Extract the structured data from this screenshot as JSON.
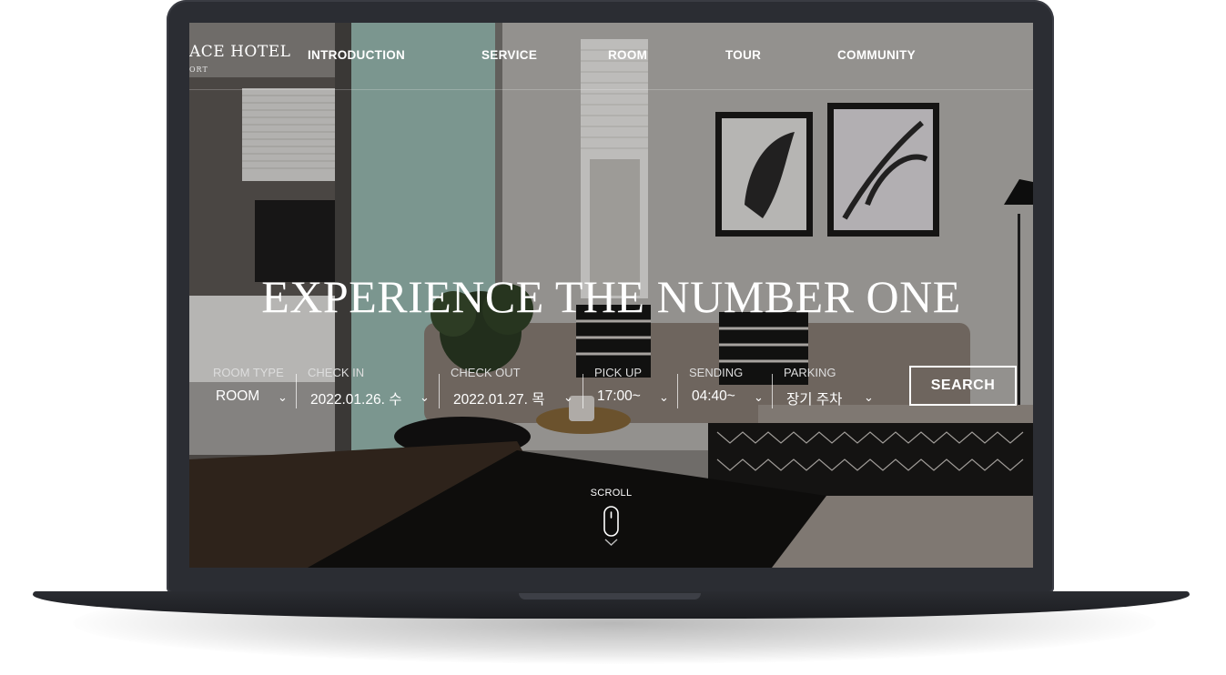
{
  "logo": {
    "name": "ACE HOTEL",
    "sub": "ORT"
  },
  "nav": {
    "items": [
      "INTRODUCTION",
      "SERVICE",
      "ROOM",
      "TOUR",
      "COMMUNITY"
    ]
  },
  "hero": {
    "title": "EXPERIENCE THE NUMBER ONE"
  },
  "booking": {
    "fields": [
      {
        "label": "ROOM TYPE",
        "value": "ROOM"
      },
      {
        "label": "CHECK IN",
        "value": "2022.01.26. 수"
      },
      {
        "label": "CHECK OUT",
        "value": "2022.01.27. 목"
      },
      {
        "label": "PICK UP",
        "value": "17:00~"
      },
      {
        "label": "SENDING",
        "value": "04:40~"
      },
      {
        "label": "PARKING",
        "value": "장기 주차"
      }
    ],
    "search_label": "SEARCH"
  },
  "scroll": {
    "label": "SCROLL"
  },
  "icons": {
    "dropdown": "chevron-down-icon",
    "scroll": "mouse-icon"
  }
}
